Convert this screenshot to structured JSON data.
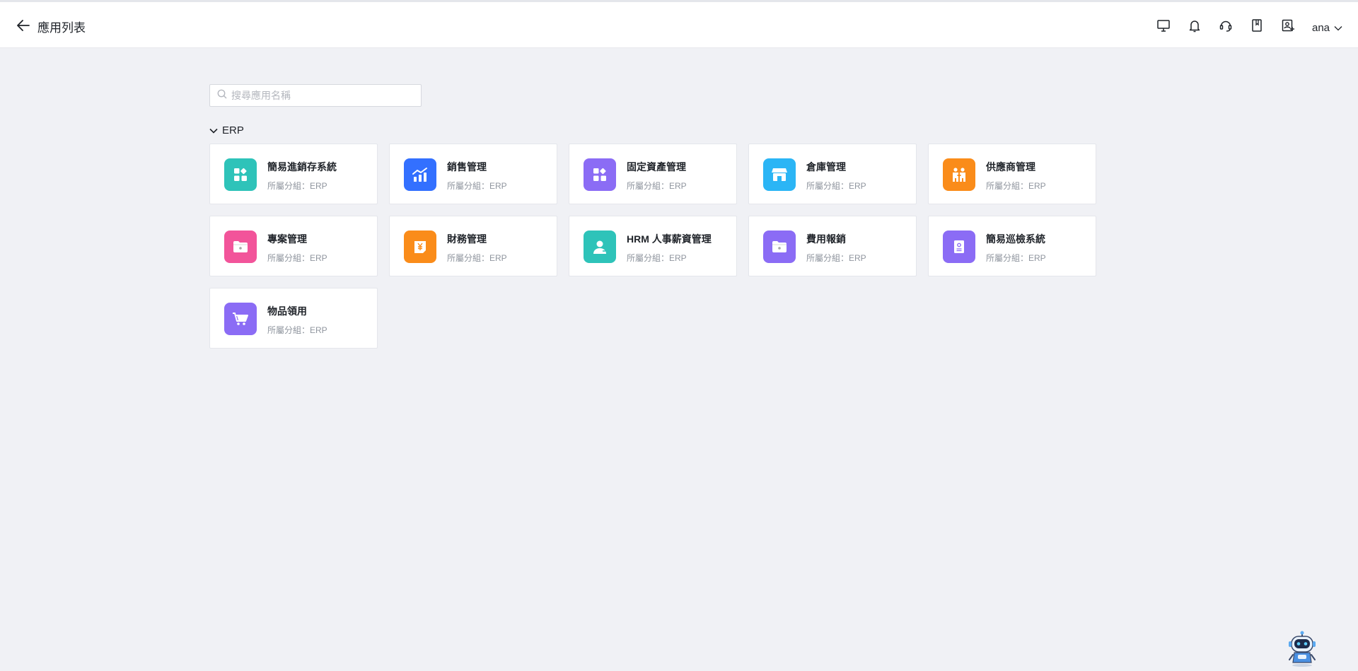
{
  "header": {
    "title": "應用列表",
    "user_name": "ana",
    "icons": [
      "monitor-icon",
      "bell-icon",
      "headset-icon",
      "book-icon",
      "user-add-icon"
    ]
  },
  "search": {
    "placeholder": "搜尋應用名稱",
    "value": ""
  },
  "group": {
    "name": "ERP",
    "expanded": true
  },
  "apps": [
    {
      "name": "簡易進銷存系統",
      "group_label": "所屬分組：ERP",
      "color": "#2ec3b9",
      "icon": "apps-grid-icon"
    },
    {
      "name": "銷售管理",
      "group_label": "所屬分組：ERP",
      "color": "#3370ff",
      "icon": "chart-trend-icon"
    },
    {
      "name": "固定資產管理",
      "group_label": "所屬分組：ERP",
      "color": "#8b6cf5",
      "icon": "apps-grid-icon"
    },
    {
      "name": "倉庫管理",
      "group_label": "所屬分組：ERP",
      "color": "#2bb5f5",
      "icon": "store-icon"
    },
    {
      "name": "供應商管理",
      "group_label": "所屬分組：ERP",
      "color": "#fa8c1a",
      "icon": "handshake-icon"
    },
    {
      "name": "專案管理",
      "group_label": "所屬分組：ERP",
      "color": "#f2549a",
      "icon": "folder-star-icon"
    },
    {
      "name": "財務管理",
      "group_label": "所屬分組：ERP",
      "color": "#fa8c1a",
      "icon": "yen-document-icon"
    },
    {
      "name": "HRM 人事薪資管理",
      "group_label": "所屬分組：ERP",
      "color": "#2ec3b9",
      "icon": "person-icon"
    },
    {
      "name": "費用報銷",
      "group_label": "所屬分組：ERP",
      "color": "#8b6cf5",
      "icon": "folder-star-icon"
    },
    {
      "name": "簡易巡檢系統",
      "group_label": "所屬分組：ERP",
      "color": "#8b6cf5",
      "icon": "badge-icon"
    },
    {
      "name": "物品領用",
      "group_label": "所屬分組：ERP",
      "color": "#8b6cf5",
      "icon": "cart-icon"
    }
  ]
}
